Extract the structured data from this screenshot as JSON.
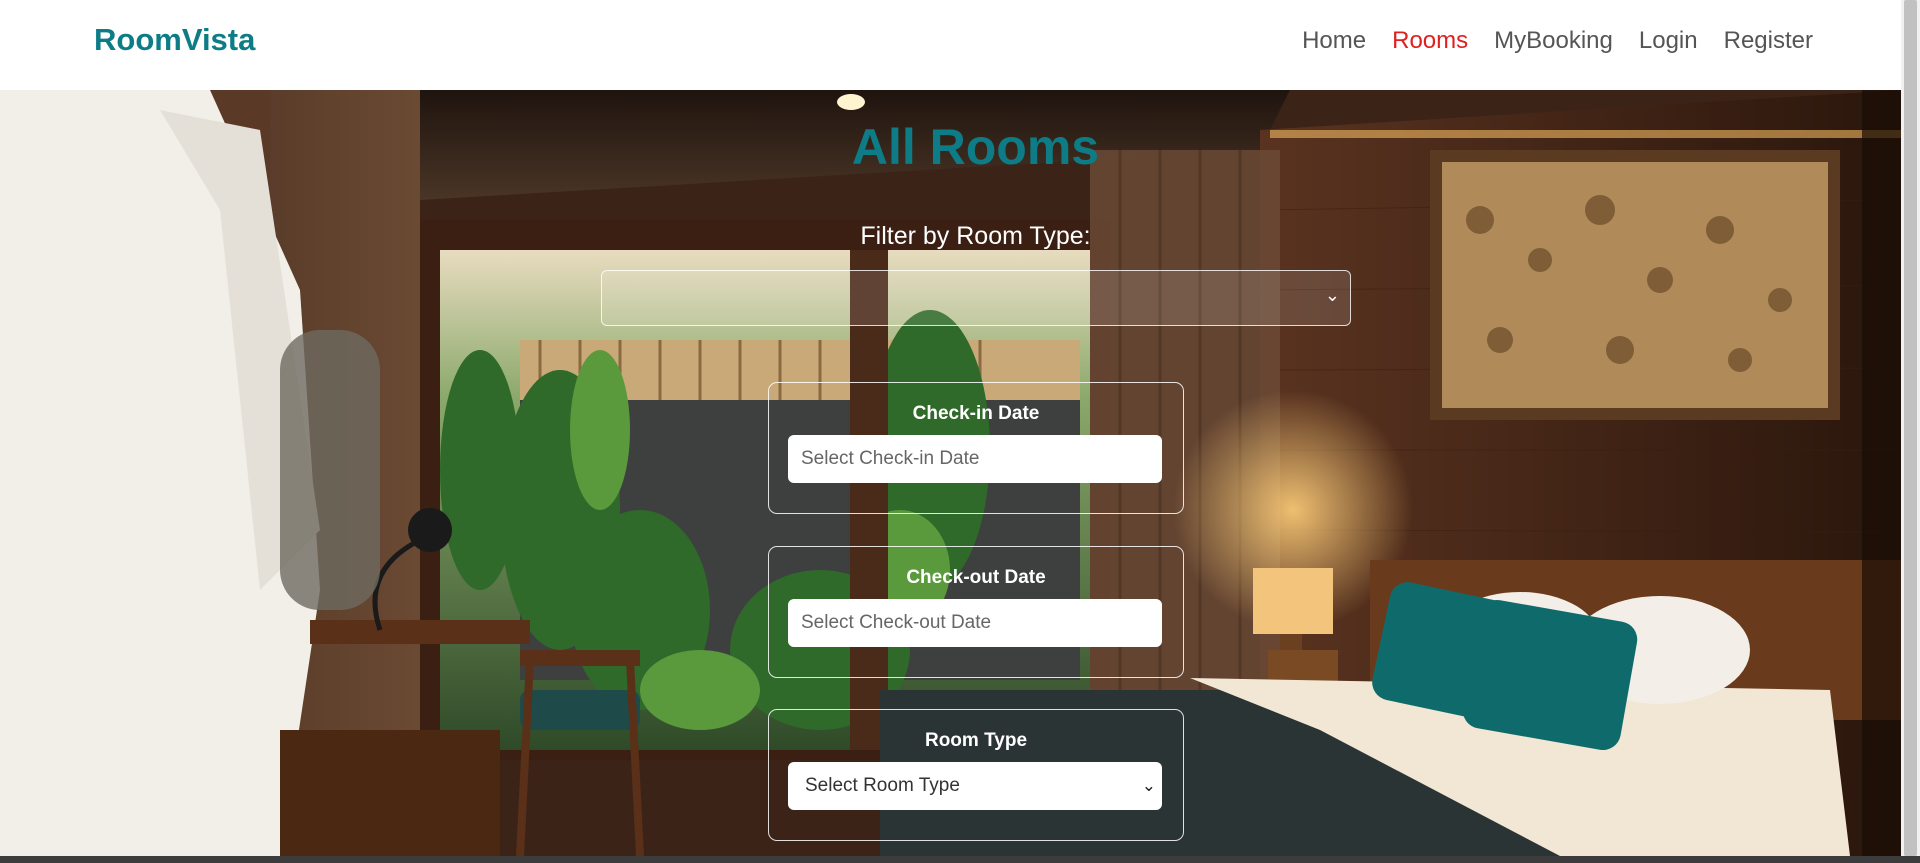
{
  "navbar": {
    "brand": "RoomVista",
    "links": [
      {
        "label": "Home",
        "active": false
      },
      {
        "label": "Rooms",
        "active": true
      },
      {
        "label": "MyBooking",
        "active": false
      },
      {
        "label": "Login",
        "active": false
      },
      {
        "label": "Register",
        "active": false
      }
    ]
  },
  "main": {
    "title": "All Rooms",
    "filter_label": "Filter by Room Type:",
    "filter_value": "",
    "checkin": {
      "label": "Check-in Date",
      "placeholder": "Select Check-in Date"
    },
    "checkout": {
      "label": "Check-out Date",
      "placeholder": "Select Check-out Date"
    },
    "room_type": {
      "label": "Room Type",
      "selected": "Select Room Type"
    }
  },
  "colors": {
    "brand": "#0e7c86",
    "active_link": "#e0201e",
    "nav_text": "#555555"
  }
}
